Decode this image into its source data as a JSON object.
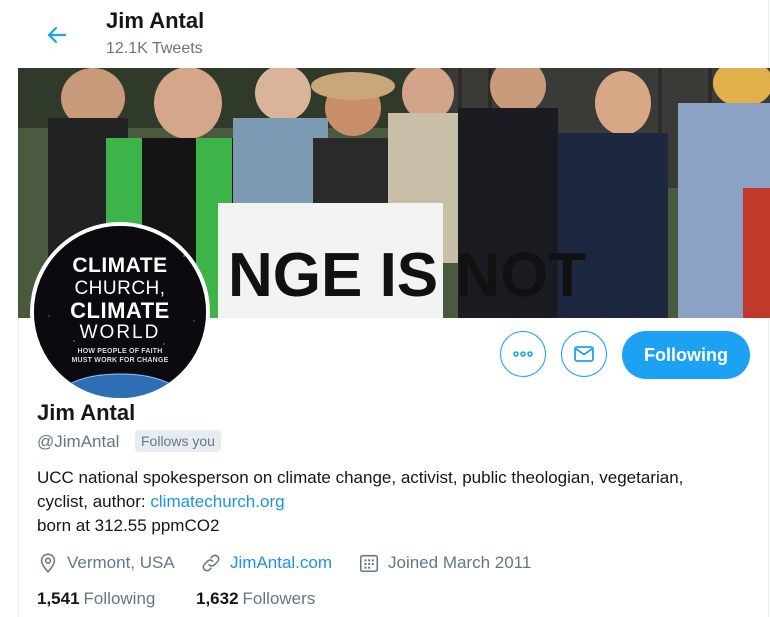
{
  "header": {
    "name": "Jim Antal",
    "tweet_count": "12.1K Tweets"
  },
  "banner": {
    "sign_text": "NGE IS NOT"
  },
  "avatar": {
    "line1": "CLIMATE",
    "line2": "CHURCH,",
    "line3": "CLIMATE",
    "line4": "WORLD",
    "sub1": "HOW PEOPLE OF FAITH",
    "sub2": "MUST WORK FOR CHANGE"
  },
  "actions": {
    "follow_label": "Following"
  },
  "profile": {
    "display_name": "Jim Antal",
    "handle": "@JimAntal",
    "follows_you": "Follows you",
    "bio_text": "UCC national spokesperson on climate change, activist, public theologian, vegetarian, cyclist, author:",
    "bio_link": "climatechurch.org",
    "bio_line2": "born at 312.55 ppmCO2"
  },
  "meta": {
    "location": "Vermont, USA",
    "website": "JimAntal.com",
    "joined": "Joined March 2011"
  },
  "stats": {
    "following_count": "1,541",
    "following_label": "Following",
    "followers_count": "1,632",
    "followers_label": "Followers"
  },
  "colors": {
    "accent": "#1da1f2",
    "link": "#1b95e0",
    "secondary_text": "#657786"
  },
  "icons": [
    "back-arrow-icon",
    "more-dots-icon",
    "envelope-icon",
    "location-pin-icon",
    "link-icon",
    "calendar-icon"
  ]
}
